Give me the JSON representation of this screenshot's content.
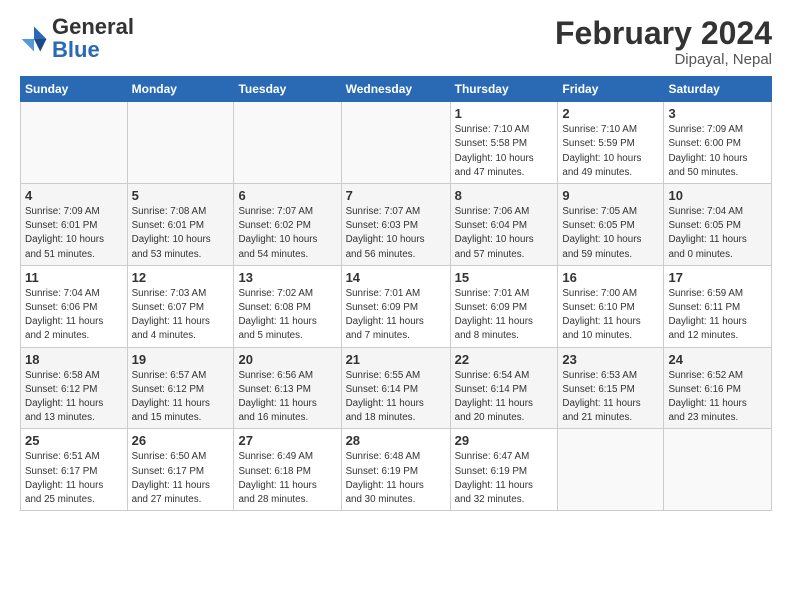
{
  "header": {
    "logo_general": "General",
    "logo_blue": "Blue",
    "month_title": "February 2024",
    "location": "Dipayal, Nepal"
  },
  "weekdays": [
    "Sunday",
    "Monday",
    "Tuesday",
    "Wednesday",
    "Thursday",
    "Friday",
    "Saturday"
  ],
  "weeks": [
    [
      {
        "day": "",
        "info": ""
      },
      {
        "day": "",
        "info": ""
      },
      {
        "day": "",
        "info": ""
      },
      {
        "day": "",
        "info": ""
      },
      {
        "day": "1",
        "info": "Sunrise: 7:10 AM\nSunset: 5:58 PM\nDaylight: 10 hours\nand 47 minutes."
      },
      {
        "day": "2",
        "info": "Sunrise: 7:10 AM\nSunset: 5:59 PM\nDaylight: 10 hours\nand 49 minutes."
      },
      {
        "day": "3",
        "info": "Sunrise: 7:09 AM\nSunset: 6:00 PM\nDaylight: 10 hours\nand 50 minutes."
      }
    ],
    [
      {
        "day": "4",
        "info": "Sunrise: 7:09 AM\nSunset: 6:01 PM\nDaylight: 10 hours\nand 51 minutes."
      },
      {
        "day": "5",
        "info": "Sunrise: 7:08 AM\nSunset: 6:01 PM\nDaylight: 10 hours\nand 53 minutes."
      },
      {
        "day": "6",
        "info": "Sunrise: 7:07 AM\nSunset: 6:02 PM\nDaylight: 10 hours\nand 54 minutes."
      },
      {
        "day": "7",
        "info": "Sunrise: 7:07 AM\nSunset: 6:03 PM\nDaylight: 10 hours\nand 56 minutes."
      },
      {
        "day": "8",
        "info": "Sunrise: 7:06 AM\nSunset: 6:04 PM\nDaylight: 10 hours\nand 57 minutes."
      },
      {
        "day": "9",
        "info": "Sunrise: 7:05 AM\nSunset: 6:05 PM\nDaylight: 10 hours\nand 59 minutes."
      },
      {
        "day": "10",
        "info": "Sunrise: 7:04 AM\nSunset: 6:05 PM\nDaylight: 11 hours\nand 0 minutes."
      }
    ],
    [
      {
        "day": "11",
        "info": "Sunrise: 7:04 AM\nSunset: 6:06 PM\nDaylight: 11 hours\nand 2 minutes."
      },
      {
        "day": "12",
        "info": "Sunrise: 7:03 AM\nSunset: 6:07 PM\nDaylight: 11 hours\nand 4 minutes."
      },
      {
        "day": "13",
        "info": "Sunrise: 7:02 AM\nSunset: 6:08 PM\nDaylight: 11 hours\nand 5 minutes."
      },
      {
        "day": "14",
        "info": "Sunrise: 7:01 AM\nSunset: 6:09 PM\nDaylight: 11 hours\nand 7 minutes."
      },
      {
        "day": "15",
        "info": "Sunrise: 7:01 AM\nSunset: 6:09 PM\nDaylight: 11 hours\nand 8 minutes."
      },
      {
        "day": "16",
        "info": "Sunrise: 7:00 AM\nSunset: 6:10 PM\nDaylight: 11 hours\nand 10 minutes."
      },
      {
        "day": "17",
        "info": "Sunrise: 6:59 AM\nSunset: 6:11 PM\nDaylight: 11 hours\nand 12 minutes."
      }
    ],
    [
      {
        "day": "18",
        "info": "Sunrise: 6:58 AM\nSunset: 6:12 PM\nDaylight: 11 hours\nand 13 minutes."
      },
      {
        "day": "19",
        "info": "Sunrise: 6:57 AM\nSunset: 6:12 PM\nDaylight: 11 hours\nand 15 minutes."
      },
      {
        "day": "20",
        "info": "Sunrise: 6:56 AM\nSunset: 6:13 PM\nDaylight: 11 hours\nand 16 minutes."
      },
      {
        "day": "21",
        "info": "Sunrise: 6:55 AM\nSunset: 6:14 PM\nDaylight: 11 hours\nand 18 minutes."
      },
      {
        "day": "22",
        "info": "Sunrise: 6:54 AM\nSunset: 6:14 PM\nDaylight: 11 hours\nand 20 minutes."
      },
      {
        "day": "23",
        "info": "Sunrise: 6:53 AM\nSunset: 6:15 PM\nDaylight: 11 hours\nand 21 minutes."
      },
      {
        "day": "24",
        "info": "Sunrise: 6:52 AM\nSunset: 6:16 PM\nDaylight: 11 hours\nand 23 minutes."
      }
    ],
    [
      {
        "day": "25",
        "info": "Sunrise: 6:51 AM\nSunset: 6:17 PM\nDaylight: 11 hours\nand 25 minutes."
      },
      {
        "day": "26",
        "info": "Sunrise: 6:50 AM\nSunset: 6:17 PM\nDaylight: 11 hours\nand 27 minutes."
      },
      {
        "day": "27",
        "info": "Sunrise: 6:49 AM\nSunset: 6:18 PM\nDaylight: 11 hours\nand 28 minutes."
      },
      {
        "day": "28",
        "info": "Sunrise: 6:48 AM\nSunset: 6:19 PM\nDaylight: 11 hours\nand 30 minutes."
      },
      {
        "day": "29",
        "info": "Sunrise: 6:47 AM\nSunset: 6:19 PM\nDaylight: 11 hours\nand 32 minutes."
      },
      {
        "day": "",
        "info": ""
      },
      {
        "day": "",
        "info": ""
      }
    ]
  ]
}
